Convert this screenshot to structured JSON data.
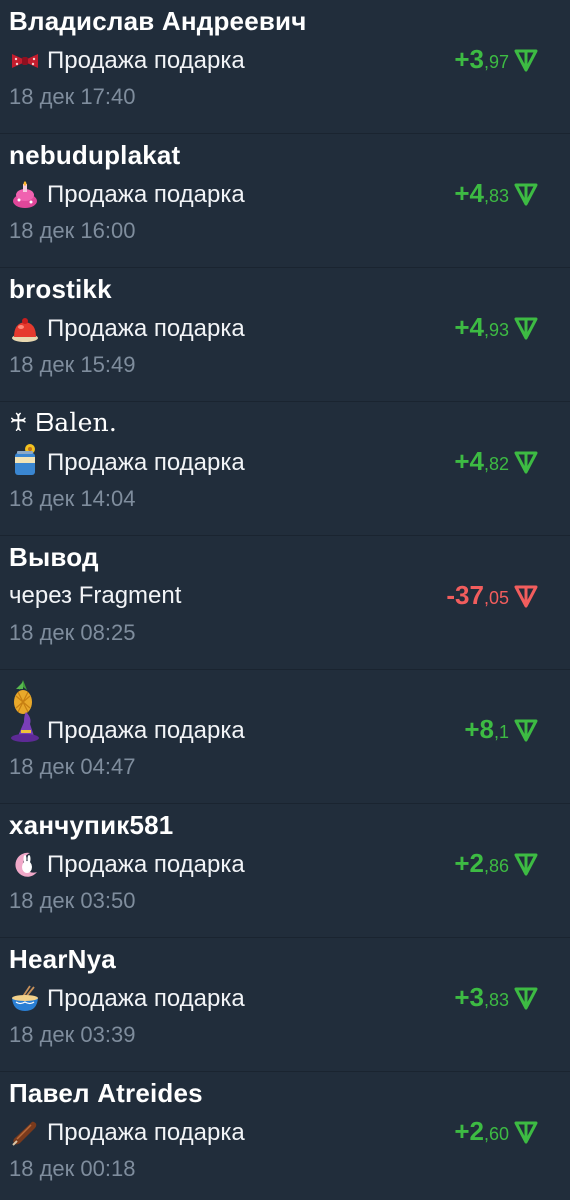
{
  "transactions": [
    {
      "title": "Владислав Андреевич",
      "subtitle": "Продажа подарка",
      "date": "18 дек 17:40",
      "amount_int": "+3",
      "amount_frac": ",97",
      "type": "pos",
      "icon": "bow-tie-icon"
    },
    {
      "title": "nebuduplakat",
      "subtitle": "Продажа подарка",
      "date": "18 дек 16:00",
      "amount_int": "+4",
      "amount_frac": ",83",
      "type": "pos",
      "icon": "cake-icon"
    },
    {
      "title": "brostikk",
      "subtitle": "Продажа подарка",
      "date": "18 дек 15:49",
      "amount_int": "+4",
      "amount_frac": ",93",
      "type": "pos",
      "icon": "jelly-icon"
    },
    {
      "title": "♰ ᗷalen.",
      "subtitle": "Продажа подарка",
      "date": "18 дек 14:04",
      "amount_int": "+4",
      "amount_frac": ",82",
      "type": "pos",
      "icon": "flower-jar-icon"
    },
    {
      "title": "Вывод",
      "subtitle": "через Fragment",
      "date": "18 дек 08:25",
      "amount_int": "-37",
      "amount_frac": ",05",
      "type": "neg",
      "icon": ""
    },
    {
      "title": "",
      "subtitle": "Продажа подарка",
      "date": "18 дек 04:47",
      "amount_int": "+8",
      "amount_frac": ",1",
      "type": "pos",
      "icon": "witch-hat-icon",
      "title_icon": "pineapple-icon"
    },
    {
      "title": "ханчупик581",
      "subtitle": "Продажа подарка",
      "date": "18 дек 03:50",
      "amount_int": "+2",
      "amount_frac": ",86",
      "type": "pos",
      "icon": "moon-bunny-icon"
    },
    {
      "title": "HearNya",
      "subtitle": "Продажа подарка",
      "date": "18 дек 03:39",
      "amount_int": "+3",
      "amount_frac": ",83",
      "type": "pos",
      "icon": "ramen-icon"
    },
    {
      "title": "Павел Atreides",
      "subtitle": "Продажа подарка",
      "date": "18 дек 00:18",
      "amount_int": "+2",
      "amount_frac": ",60",
      "type": "pos",
      "icon": "sausage-icon"
    }
  ],
  "colors": {
    "background": "#212d3b",
    "positive": "#3dbb43",
    "negative": "#f25d5d",
    "date": "#7f8d9d"
  },
  "currency_icon": "ton-icon"
}
